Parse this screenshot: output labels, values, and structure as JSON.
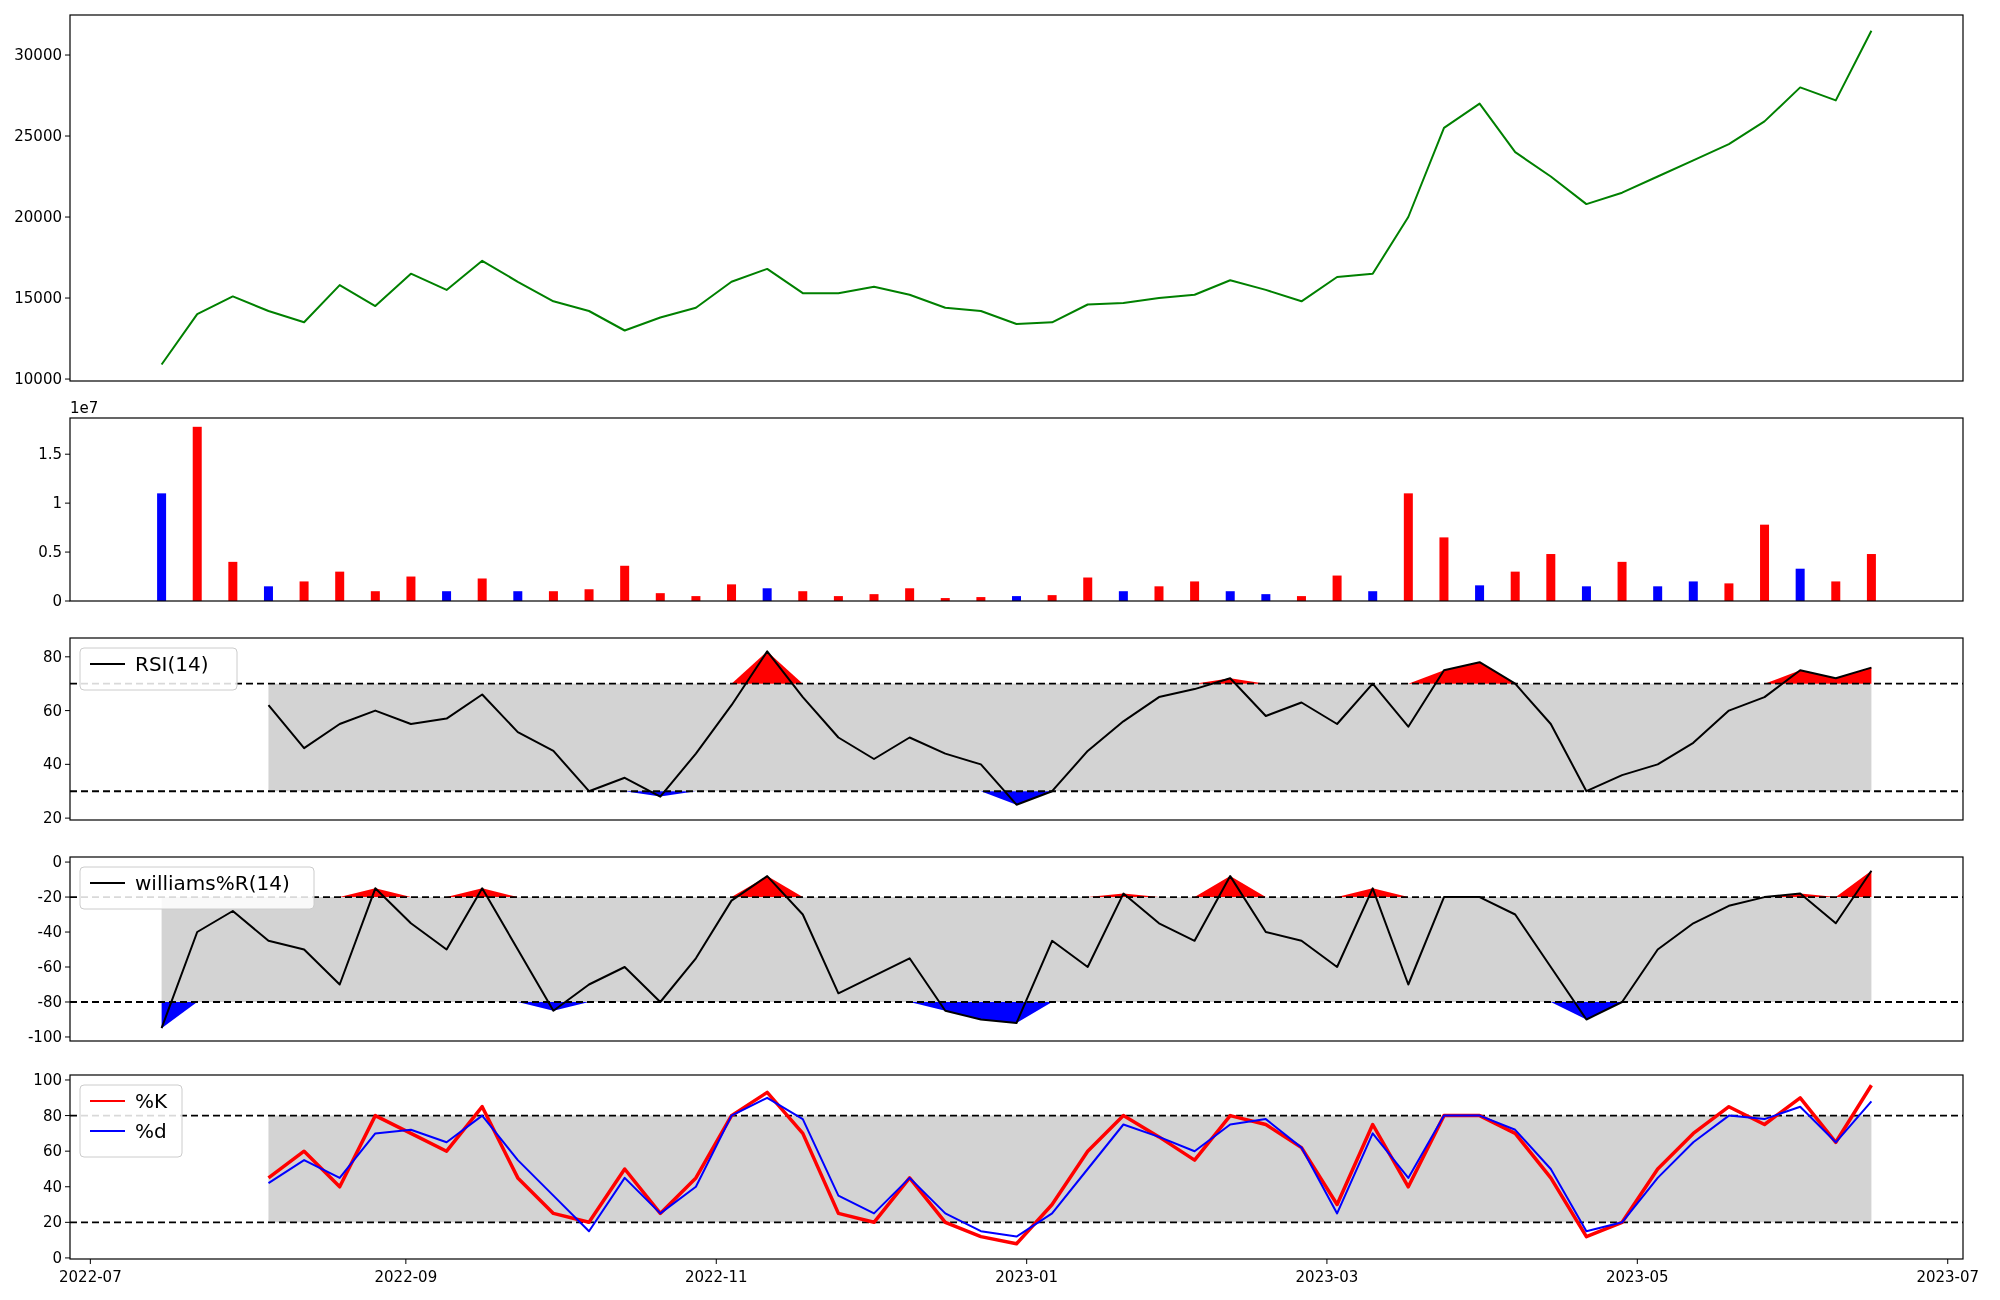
{
  "panels": [
    {
      "chart_data": {
        "type": "line",
        "x": [
          "2022-07-15",
          "2022-07-22",
          "2022-07-29",
          "2022-08-05",
          "2022-08-12",
          "2022-08-19",
          "2022-08-26",
          "2022-09-02",
          "2022-09-09",
          "2022-09-16",
          "2022-09-23",
          "2022-09-30",
          "2022-10-07",
          "2022-10-14",
          "2022-10-21",
          "2022-10-28",
          "2022-11-04",
          "2022-11-11",
          "2022-11-18",
          "2022-11-25",
          "2022-12-02",
          "2022-12-09",
          "2022-12-16",
          "2022-12-23",
          "2022-12-30",
          "2023-01-06",
          "2023-01-13",
          "2023-01-20",
          "2023-01-27",
          "2023-02-03",
          "2023-02-10",
          "2023-02-17",
          "2023-02-24",
          "2023-03-03",
          "2023-03-10",
          "2023-03-17",
          "2023-03-24",
          "2023-03-31",
          "2023-04-07",
          "2023-04-14",
          "2023-04-21",
          "2023-04-28",
          "2023-05-05",
          "2023-05-12",
          "2023-05-19",
          "2023-05-26",
          "2023-06-02",
          "2023-06-09",
          "2023-06-16"
        ],
        "xlim": [
          "2022-06-27",
          "2023-07-04"
        ],
        "ylim": [
          9880,
          32470
        ],
        "yticks": [
          10000,
          15000,
          20000,
          25000,
          30000
        ],
        "series": [
          {
            "color": "#008000",
            "values": [
              10900,
              14000,
              15100,
              14200,
              13500,
              15800,
              14500,
              16500,
              15500,
              17300,
              16000,
              14800,
              14200,
              13000,
              13800,
              14400,
              16000,
              16800,
              15300,
              15300,
              15700,
              15200,
              14400,
              14200,
              13400,
              13500,
              14600,
              14700,
              15000,
              15200,
              16100,
              15500,
              14800,
              16300,
              16500,
              20000,
              25500,
              27000,
              24000,
              22500,
              20800,
              21500,
              22500,
              23500,
              24500,
              25900,
              28000,
              27200,
              31500
            ]
          }
        ]
      }
    },
    {
      "chart_data": {
        "type": "bar",
        "x": [
          "2022-07-15",
          "2022-07-22",
          "2022-07-29",
          "2022-08-05",
          "2022-08-12",
          "2022-08-19",
          "2022-08-26",
          "2022-09-02",
          "2022-09-09",
          "2022-09-16",
          "2022-09-23",
          "2022-09-30",
          "2022-10-07",
          "2022-10-14",
          "2022-10-21",
          "2022-10-28",
          "2022-11-04",
          "2022-11-11",
          "2022-11-18",
          "2022-11-25",
          "2022-12-02",
          "2022-12-09",
          "2022-12-16",
          "2022-12-23",
          "2022-12-30",
          "2023-01-06",
          "2023-01-13",
          "2023-01-20",
          "2023-01-27",
          "2023-02-03",
          "2023-02-10",
          "2023-02-17",
          "2023-02-24",
          "2023-03-03",
          "2023-03-10",
          "2023-03-17",
          "2023-03-24",
          "2023-03-31",
          "2023-04-07",
          "2023-04-14",
          "2023-04-21",
          "2023-04-28",
          "2023-05-05",
          "2023-05-12",
          "2023-05-19",
          "2023-05-26",
          "2023-06-02",
          "2023-06-09",
          "2023-06-16"
        ],
        "xlim": [
          "2022-06-27",
          "2023-07-04"
        ],
        "ylim": [
          0,
          1.87
        ],
        "yticks": [
          0,
          0.5,
          1,
          1.5
        ],
        "annotations": [
          {
            "text": "1e7"
          }
        ],
        "series": [
          {
            "color": "#ff0000",
            "values": [
              null,
              1.78,
              0.4,
              null,
              0.2,
              0.3,
              0.1,
              0.25,
              null,
              0.23,
              null,
              0.1,
              0.12,
              0.36,
              0.08,
              0.05,
              0.17,
              null,
              0.1,
              0.05,
              0.07,
              0.13,
              0.03,
              0.04,
              null,
              0.06,
              0.24,
              null,
              0.15,
              0.2,
              null,
              null,
              0.05,
              0.26,
              null,
              1.1,
              0.65,
              null,
              0.3,
              0.48,
              null,
              0.4,
              null,
              null,
              0.18,
              0.78,
              null,
              0.2,
              0.48
            ]
          },
          {
            "color": "#0000ff",
            "values": [
              1.1,
              null,
              null,
              0.15,
              null,
              null,
              null,
              null,
              0.1,
              null,
              0.1,
              null,
              null,
              null,
              null,
              null,
              null,
              0.13,
              null,
              null,
              null,
              null,
              null,
              null,
              0.05,
              null,
              null,
              0.1,
              null,
              null,
              0.1,
              0.07,
              null,
              null,
              0.1,
              null,
              null,
              0.16,
              null,
              null,
              0.15,
              null,
              0.15,
              0.2,
              null,
              null,
              0.33,
              null,
              null
            ]
          }
        ]
      }
    },
    {
      "chart_data": {
        "type": "line",
        "x": [
          "2022-08-05",
          "2022-08-12",
          "2022-08-19",
          "2022-08-26",
          "2022-09-02",
          "2022-09-09",
          "2022-09-16",
          "2022-09-23",
          "2022-09-30",
          "2022-10-07",
          "2022-10-14",
          "2022-10-21",
          "2022-10-28",
          "2022-11-04",
          "2022-11-11",
          "2022-11-18",
          "2022-11-25",
          "2022-12-02",
          "2022-12-09",
          "2022-12-16",
          "2022-12-23",
          "2022-12-30",
          "2023-01-06",
          "2023-01-13",
          "2023-01-20",
          "2023-01-27",
          "2023-02-03",
          "2023-02-10",
          "2023-02-17",
          "2023-02-24",
          "2023-03-03",
          "2023-03-10",
          "2023-03-17",
          "2023-03-24",
          "2023-03-31",
          "2023-04-07",
          "2023-04-14",
          "2023-04-21",
          "2023-04-28",
          "2023-05-05",
          "2023-05-12",
          "2023-05-19",
          "2023-05-26",
          "2023-06-02",
          "2023-06-09",
          "2023-06-16"
        ],
        "xlim": [
          "2022-06-27",
          "2023-07-04"
        ],
        "ylim": [
          19.3,
          87
        ],
        "yticks": [
          20,
          40,
          60,
          80
        ],
        "legend": true,
        "ref_lines": [
          {
            "axis": "y",
            "value": 70
          },
          {
            "axis": "y",
            "value": 30
          }
        ],
        "bands": [
          {
            "axis": "y",
            "from": 30,
            "to": 70,
            "color": "#d3d3d3"
          }
        ],
        "series": [
          {
            "type": "area",
            "color": "#ff0000",
            "values": [
              null,
              null,
              null,
              null,
              null,
              null,
              null,
              null,
              null,
              null,
              null,
              null,
              null,
              70,
              82,
              70,
              null,
              null,
              null,
              null,
              null,
              null,
              null,
              null,
              null,
              null,
              70,
              72,
              70,
              null,
              null,
              null,
              70,
              75,
              78,
              70,
              null,
              null,
              null,
              null,
              null,
              null,
              70,
              75,
              72,
              76
            ]
          },
          {
            "type": "area",
            "color": "#0000ff",
            "values": [
              null,
              null,
              null,
              null,
              null,
              null,
              null,
              null,
              null,
              null,
              30,
              28,
              30,
              null,
              null,
              null,
              null,
              null,
              null,
              null,
              30,
              25,
              30,
              null,
              null,
              null,
              null,
              null,
              null,
              null,
              null,
              null,
              null,
              null,
              null,
              null,
              null,
              null,
              null,
              null,
              null,
              null,
              null,
              null,
              null,
              null
            ]
          },
          {
            "name": "RSI(14)",
            "color": "#000000",
            "values": [
              62,
              46,
              55,
              60,
              55,
              57,
              66,
              52,
              45,
              30,
              35,
              28,
              44,
              62,
              82,
              65,
              50,
              42,
              50,
              44,
              40,
              25,
              30,
              45,
              56,
              65,
              68,
              72,
              58,
              63,
              55,
              70,
              54,
              75,
              78,
              70,
              55,
              30,
              36,
              40,
              48,
              60,
              65,
              75,
              72,
              76
            ]
          }
        ]
      }
    },
    {
      "chart_data": {
        "type": "line",
        "x": [
          "2022-07-15",
          "2022-07-22",
          "2022-07-29",
          "2022-08-05",
          "2022-08-12",
          "2022-08-19",
          "2022-08-26",
          "2022-09-02",
          "2022-09-09",
          "2022-09-16",
          "2022-09-23",
          "2022-09-30",
          "2022-10-07",
          "2022-10-14",
          "2022-10-21",
          "2022-10-28",
          "2022-11-04",
          "2022-11-11",
          "2022-11-18",
          "2022-11-25",
          "2022-12-02",
          "2022-12-09",
          "2022-12-16",
          "2022-12-23",
          "2022-12-30",
          "2023-01-06",
          "2023-01-13",
          "2023-01-20",
          "2023-01-27",
          "2023-02-03",
          "2023-02-10",
          "2023-02-17",
          "2023-02-24",
          "2023-03-03",
          "2023-03-10",
          "2023-03-17",
          "2023-03-24",
          "2023-03-31",
          "2023-04-07",
          "2023-04-14",
          "2023-04-21",
          "2023-04-28",
          "2023-05-05",
          "2023-05-12",
          "2023-05-19",
          "2023-05-26",
          "2023-06-02",
          "2023-06-09",
          "2023-06-16"
        ],
        "xlim": [
          "2022-06-27",
          "2023-07-04"
        ],
        "ylim": [
          -102.3,
          2.9
        ],
        "yticks": [
          -100,
          -80,
          -60,
          -40,
          -20,
          0
        ],
        "legend": true,
        "ref_lines": [
          {
            "axis": "y",
            "value": -20
          },
          {
            "axis": "y",
            "value": -80
          }
        ],
        "bands": [
          {
            "axis": "y",
            "from": -80,
            "to": -20,
            "color": "#d3d3d3"
          }
        ],
        "series": [
          {
            "type": "area",
            "color": "#ff0000",
            "values": [
              null,
              null,
              null,
              null,
              null,
              -20,
              -15,
              -20,
              -20,
              -15,
              -20,
              null,
              null,
              null,
              null,
              null,
              -20,
              -8,
              -20,
              null,
              null,
              null,
              null,
              null,
              null,
              null,
              -20,
              -18,
              -20,
              -20,
              -8,
              -20,
              null,
              -20,
              -15,
              -20,
              null,
              null,
              null,
              null,
              null,
              null,
              null,
              null,
              null,
              -20,
              -18,
              -20,
              -5
            ]
          },
          {
            "type": "area",
            "color": "#0000ff",
            "values": [
              -95,
              -80,
              null,
              null,
              null,
              null,
              null,
              null,
              null,
              null,
              -80,
              -85,
              -80,
              null,
              null,
              null,
              null,
              null,
              null,
              null,
              null,
              -80,
              -85,
              -90,
              -92,
              -80,
              null,
              null,
              null,
              null,
              null,
              null,
              null,
              null,
              null,
              null,
              null,
              null,
              null,
              -80,
              -90,
              -80,
              null,
              null,
              null,
              null,
              null,
              null,
              null
            ]
          },
          {
            "name": "williams%R(14)",
            "color": "#000000",
            "values": [
              -95,
              -40,
              -28,
              -45,
              -50,
              -70,
              -15,
              -35,
              -50,
              -15,
              -50,
              -85,
              -70,
              -60,
              -80,
              -55,
              -22,
              -8,
              -30,
              -75,
              -65,
              -55,
              -85,
              -90,
              -92,
              -45,
              -60,
              -18,
              -35,
              -45,
              -8,
              -40,
              -45,
              -60,
              -15,
              -70,
              -20,
              -20,
              -30,
              -60,
              -90,
              -80,
              -50,
              -35,
              -25,
              -20,
              -18,
              -35,
              -5
            ]
          }
        ]
      }
    },
    {
      "chart_data": {
        "type": "line",
        "x": [
          "2022-08-05",
          "2022-08-12",
          "2022-08-19",
          "2022-08-26",
          "2022-09-02",
          "2022-09-09",
          "2022-09-16",
          "2022-09-23",
          "2022-09-30",
          "2022-10-07",
          "2022-10-14",
          "2022-10-21",
          "2022-10-28",
          "2022-11-04",
          "2022-11-11",
          "2022-11-18",
          "2022-11-25",
          "2022-12-02",
          "2022-12-09",
          "2022-12-16",
          "2022-12-23",
          "2022-12-30",
          "2023-01-06",
          "2023-01-13",
          "2023-01-20",
          "2023-01-27",
          "2023-02-03",
          "2023-02-10",
          "2023-02-17",
          "2023-02-24",
          "2023-03-03",
          "2023-03-10",
          "2023-03-17",
          "2023-03-24",
          "2023-03-31",
          "2023-04-07",
          "2023-04-14",
          "2023-04-21",
          "2023-04-28",
          "2023-05-05",
          "2023-05-12",
          "2023-05-19",
          "2023-05-26",
          "2023-06-02",
          "2023-06-09",
          "2023-06-16"
        ],
        "xlim": [
          "2022-06-27",
          "2023-07-04"
        ],
        "ylim": [
          -0.6,
          102.8
        ],
        "yticks": [
          0,
          20,
          40,
          60,
          80,
          100
        ],
        "xticks": [
          {
            "value": "2022-07-01",
            "label": "2022-07"
          },
          {
            "value": "2022-09-01",
            "label": "2022-09"
          },
          {
            "value": "2022-11-01",
            "label": "2022-11"
          },
          {
            "value": "2023-01-01",
            "label": "2023-01"
          },
          {
            "value": "2023-03-01",
            "label": "2023-03"
          },
          {
            "value": "2023-05-01",
            "label": "2023-05"
          },
          {
            "value": "2023-07-01",
            "label": "2023-07"
          }
        ],
        "legend": true,
        "ref_lines": [
          {
            "axis": "y",
            "value": 80
          },
          {
            "axis": "y",
            "value": 20
          }
        ],
        "bands": [
          {
            "axis": "y",
            "from": 20,
            "to": 80,
            "color": "#d3d3d3"
          }
        ],
        "series": [
          {
            "name": "%K",
            "color": "#ff0000",
            "values": [
              45,
              60,
              40,
              80,
              70,
              60,
              85,
              45,
              25,
              20,
              50,
              25,
              45,
              80,
              93,
              70,
              25,
              20,
              45,
              20,
              12,
              8,
              30,
              60,
              80,
              68,
              55,
              80,
              75,
              62,
              30,
              75,
              40,
              80,
              80,
              70,
              45,
              12,
              20,
              50,
              70,
              85,
              75,
              90,
              65,
              97
            ]
          },
          {
            "name": "%d",
            "color": "#0000ff",
            "values": [
              42,
              55,
              45,
              70,
              72,
              65,
              80,
              55,
              35,
              15,
              45,
              25,
              40,
              80,
              90,
              78,
              35,
              25,
              45,
              25,
              15,
              12,
              25,
              50,
              75,
              68,
              60,
              75,
              78,
              62,
              25,
              70,
              45,
              80,
              80,
              72,
              50,
              15,
              20,
              45,
              65,
              80,
              78,
              85,
              65,
              88
            ]
          }
        ]
      }
    }
  ]
}
